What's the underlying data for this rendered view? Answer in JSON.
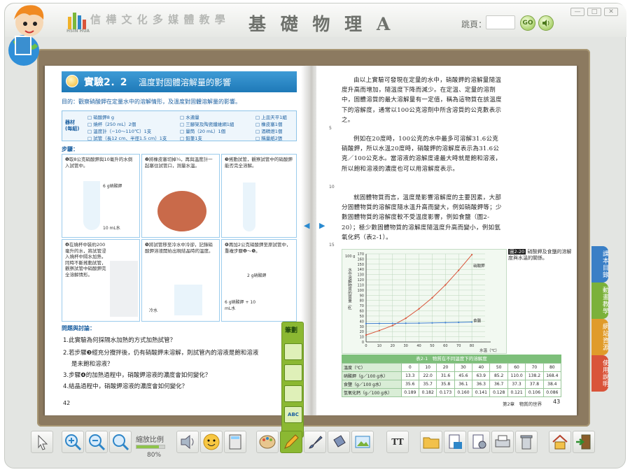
{
  "window": {
    "title": "基 礎 物 理 A",
    "brand": "信 樺 文 化 多 媒 體 教 學",
    "brand_sub": "HSIN HUA",
    "jump_label": "跳頁：",
    "go": "GO"
  },
  "left_page": {
    "exp_title": "實驗2．2",
    "exp_subtitle": "溫度對固體溶解量的影響",
    "purpose": "目的：觀察硝酸鉀在定量水中的溶解情形，及溫度對固體溶解量的影響。",
    "materials_label": "器材 (每組)",
    "materials": [
      "□ 硝酸鉀8 g",
      "□ 燒杯（250 mL）2個",
      "□ 溫度計（−10～110℃）1支",
      "□ 試管（長12 cm、半徑1.5 cm）1支",
      "□ 水適量",
      "□ 三腳架及陶瓷纖維網1組",
      "□ 量筒（20 mL）1個",
      "□ 鉛筆1支",
      "□ 上皿天平1組",
      "□ 橡皮塞1個",
      "□ 酒精燈1個",
      "□ 稱量紙2張"
    ],
    "steps_label": "步驟：",
    "steps": [
      "❶取8公克硝酸鉀與10毫升的水倒入試管中。",
      "❷將橡皮塞切掉¼，再與溫度計一起塞住試管口，測量水溫。",
      "❸搖動試管，觀察試管中的硝酸鉀能否完全溶解。",
      "❹在燒杯中裝約200毫升的水，將試管浸入燒杯中隔水加熱，同時不斷搖動試管，觀察試管中硝酸鉀完全溶解情形。",
      "❺將試管移至冷水中冷卻，記錄硝酸鉀溶液開始出現結晶時的溫度。",
      "❻再加2公克硝酸鉀至原試管中，重複步驟❹～❺。"
    ],
    "step_labels": [
      "6 g硝酸鉀",
      "10 mL水",
      "冷水",
      "6 g硝酸鉀 + 10 mL水",
      "2 g硝酸鉀"
    ],
    "questions_title": "問題與討論：",
    "questions": [
      "1.此實驗為何採隔水加熱的方式加熱試管？",
      "2.若步驟❸經充分攪拌後，仍有硝酸鉀未溶解，則試管內的溶液是飽和溶液",
      "是未飽和溶液？",
      "3.步驟❹的加熱過程中，硝酸鉀溶液的濃度會如何變化？",
      "4.結晶過程中，硝酸鉀溶液的濃度會如何變化？"
    ],
    "page_number": "42"
  },
  "right_page": {
    "paragraphs": [
      "由以上實驗可發現在定量的水中，硝酸鉀的溶解量隨溫度升高而增加，隨溫度下降而減少。在定溫、定量的溶劑中，固體溶質的最大溶解量有一定值，稱為這物質在該溫度下的溶解度，通常以100公克溶劑中所含溶質的公克數表示之。",
      "例如在20度時，100公克的水中最多可溶解31.6公克硝酸鉀，所以水溫20度時，硝酸鉀的溶解度表示為31.6公克／100公克水。當溶液的溶解度達最大時就是飽和溶液，所以飽和溶液的濃度也可以用溶解度表示。",
      "就固體物質而言，溫度是影響溶解度的主要因素，大部分固體物質的溶解度隨水溫升高而變大，例如硝酸鉀等；少數固體物質的溶解度較不受溫度影響，例如食鹽（圖2-20）；極少數固體物質的溶解度隨溫度升高而變小，例如氫氧化鈣（表2-1）。"
    ],
    "line_numbers": [
      "5",
      "10",
      "15"
    ],
    "figure_tag": "圖2-20",
    "figure_caption": "硝酸鉀及食鹽的溶解度與水溫的關係。",
    "table_title": "表2-1　物質在不同溫度下的溶解度",
    "table": [
      [
        "溫度（℃）",
        "0",
        "10",
        "20",
        "30",
        "40",
        "50",
        "60",
        "70",
        "80"
      ],
      [
        "硝酸鉀（g／100 g水）",
        "13.3",
        "22.0",
        "31.6",
        "45.6",
        "63.9",
        "85.2",
        "110.0",
        "138.2",
        "168.4"
      ],
      [
        "食鹽（g／100 g水）",
        "35.6",
        "35.7",
        "35.8",
        "36.1",
        "36.3",
        "36.7",
        "37.3",
        "37.8",
        "38.4"
      ],
      [
        "氫氧化鈣（g／100 g水）",
        "0.189",
        "0.182",
        "0.173",
        "0.160",
        "0.141",
        "0.128",
        "0.121",
        "0.106",
        "0.086"
      ]
    ],
    "footer": "第2章　物質的世界",
    "page_number": "43"
  },
  "chart_data": {
    "type": "line",
    "x": [
      0,
      10,
      20,
      30,
      40,
      50,
      60,
      70,
      80
    ],
    "series": [
      {
        "name": "硝酸鉀",
        "values": [
          13.3,
          22.0,
          31.6,
          45.6,
          63.9,
          85.2,
          110.0,
          138.2,
          168.4
        ],
        "color": "#d9543a"
      },
      {
        "name": "食鹽",
        "values": [
          35.6,
          35.7,
          35.8,
          36.1,
          36.3,
          36.7,
          37.3,
          37.8,
          38.4
        ],
        "color": "#3f7fd0"
      }
    ],
    "xlabel": "水溫（℃）",
    "ylabel": "水中溶解物質的質量（g）",
    "ytop_label": "100 g",
    "yticks": [
      0,
      10,
      20,
      30,
      40,
      50,
      60,
      70,
      80,
      90,
      100,
      110,
      120,
      130,
      140,
      150,
      160,
      170
    ],
    "xticks": [
      0,
      10,
      20,
      30,
      40,
      50,
      60,
      70,
      80
    ],
    "xlim": [
      0,
      90
    ],
    "ylim": [
      0,
      170
    ],
    "grid": true
  },
  "side_tabs": [
    {
      "label": "課本目錄",
      "color": "#3a7fc6"
    },
    {
      "label": "動畫教學",
      "color": "#7bb13a"
    },
    {
      "label": "網站資源",
      "color": "#e09b2a"
    },
    {
      "label": "使用說明",
      "color": "#d9543a"
    }
  ],
  "pen_popup": {
    "title": "筆劃",
    "abc": "ABC"
  },
  "toolbar": {
    "zoom_label": "縮放比例",
    "zoom_value": "80%",
    "zoom_percent": 80,
    "text_tool": "TT"
  }
}
